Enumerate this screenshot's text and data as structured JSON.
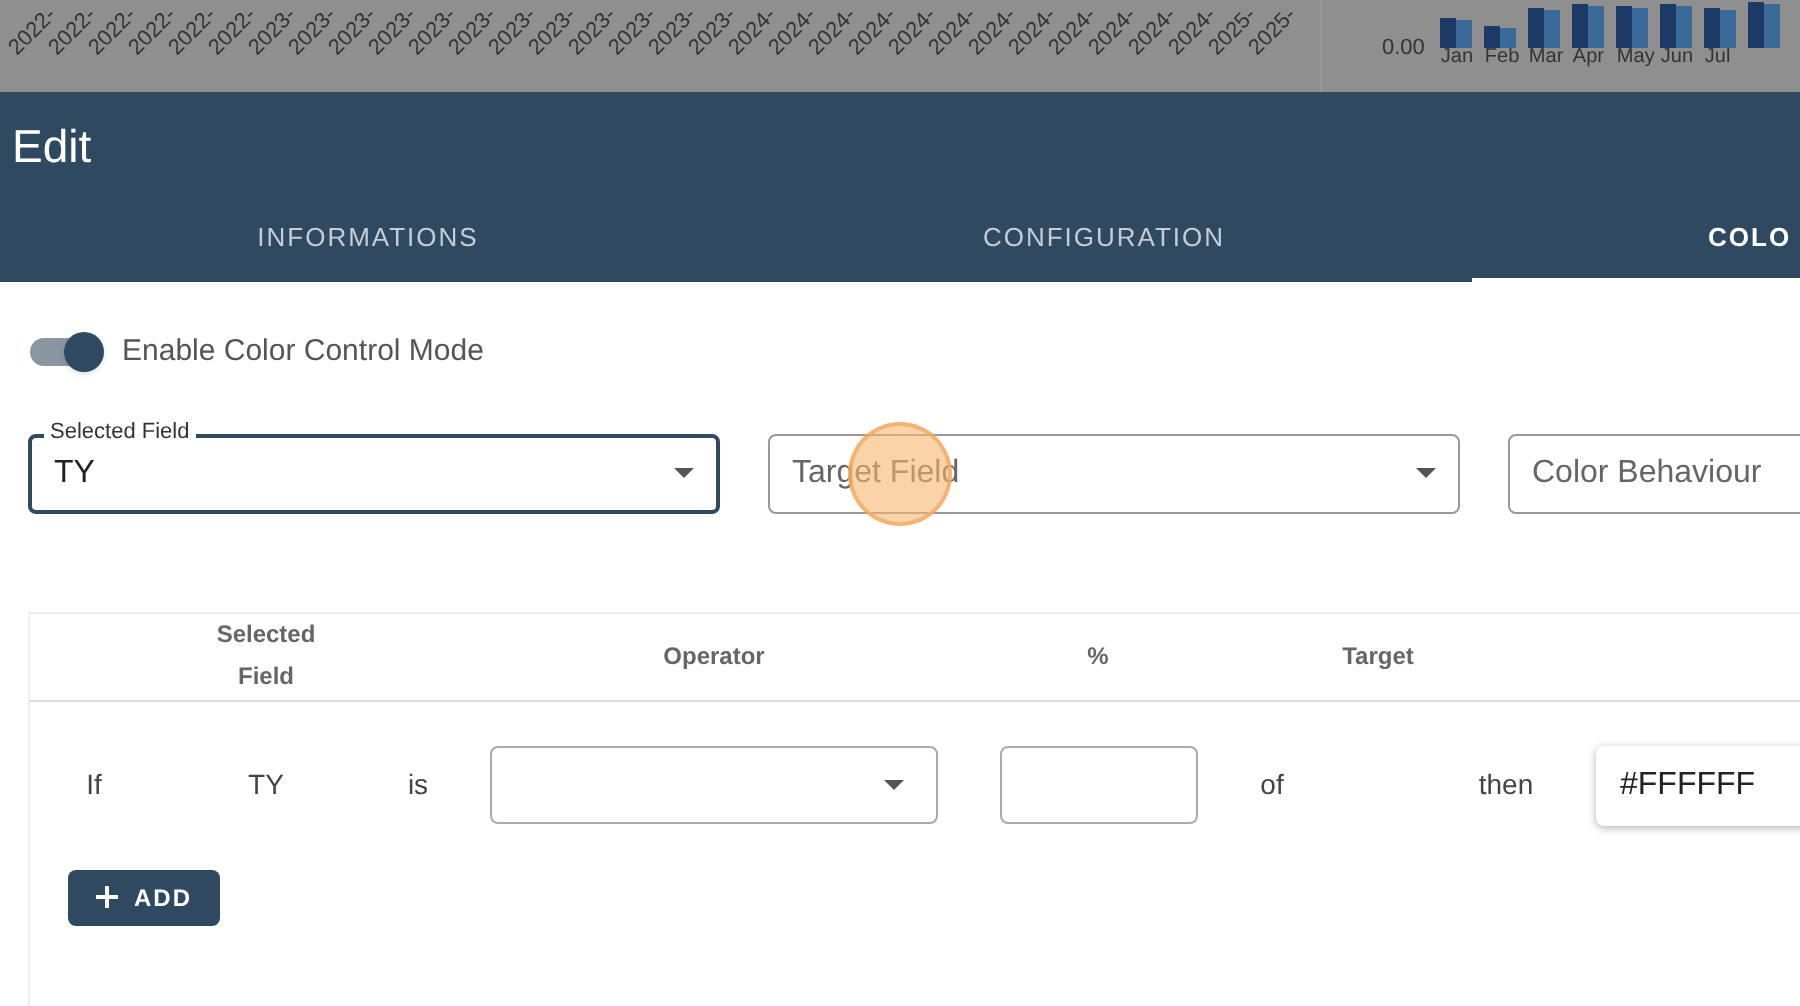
{
  "backdrop": {
    "date_labels": [
      "2022-",
      "2022-",
      "2022-",
      "2022-",
      "2022-",
      "2022-",
      "2023-",
      "2023-",
      "2023-",
      "2023-",
      "2023-",
      "2023-",
      "2023-",
      "2023-",
      "2023-",
      "2023-",
      "2023-",
      "2023-",
      "2024-",
      "2024-",
      "2024-",
      "2024-",
      "2024-",
      "2024-",
      "2024-",
      "2024-",
      "2024-",
      "2024-",
      "2024-",
      "2024-",
      "2025-",
      "2025-"
    ],
    "y_tick": "0.00",
    "months": [
      "Jan",
      "Feb",
      "Mar",
      "Apr",
      "May",
      "Jun",
      "Jul"
    ]
  },
  "dialog": {
    "title": "Edit",
    "tabs": [
      {
        "label": "INFORMATIONS",
        "selected": false
      },
      {
        "label": "CONFIGURATION",
        "selected": false
      },
      {
        "label": "COLO",
        "selected": true
      }
    ],
    "toggle": {
      "label": "Enable Color Control Mode",
      "on": true
    },
    "fields": [
      {
        "label": "Selected Field",
        "value": "TY",
        "focused": true
      },
      {
        "placeholder": "Target Field",
        "focused": false
      },
      {
        "placeholder": "Color Behaviour",
        "focused": false
      }
    ],
    "table": {
      "columns": [
        "",
        "Selected Field",
        "",
        "Operator",
        "%",
        "",
        "Target",
        "",
        ""
      ],
      "rows": [
        {
          "cells": [
            {
              "kind": "text",
              "text": "If"
            },
            {
              "kind": "text",
              "text": "TY"
            },
            {
              "kind": "text",
              "text": "is"
            },
            {
              "kind": "select"
            },
            {
              "kind": "input"
            },
            {
              "kind": "text",
              "text": "of"
            },
            {
              "kind": "empty"
            },
            {
              "kind": "text",
              "text": "then"
            },
            {
              "kind": "color",
              "text": "#FFFFFF"
            }
          ]
        }
      ]
    },
    "add_button": "ADD"
  }
}
